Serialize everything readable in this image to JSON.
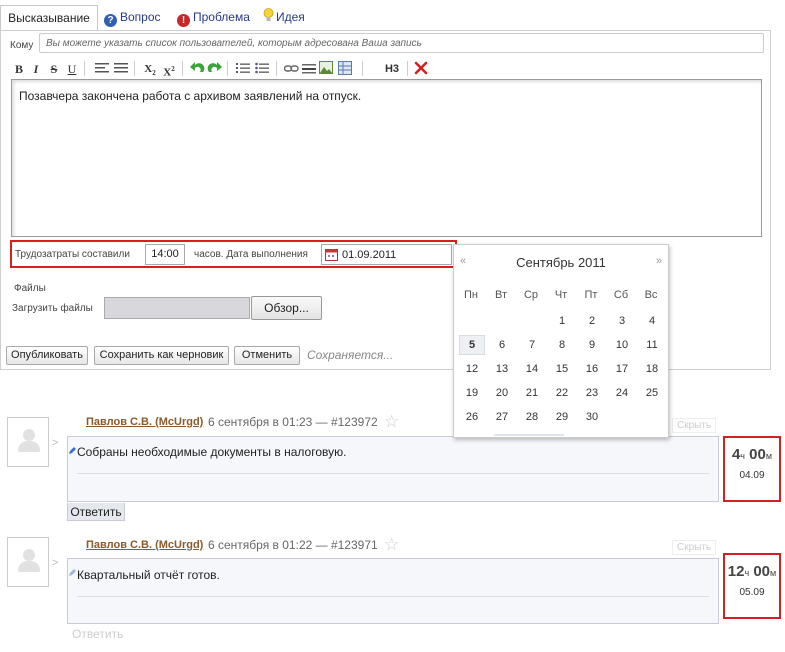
{
  "tabs": [
    {
      "label": "Высказывание",
      "icon": "speech"
    },
    {
      "label": "Вопрос",
      "icon": "question-icon",
      "color": "#2f5fb6"
    },
    {
      "label": "Проблема",
      "icon": "exclamation-icon",
      "color": "#c8262b"
    },
    {
      "label": "Идея",
      "icon": "lightbulb-icon",
      "color": "#f0c419"
    }
  ],
  "to": {
    "label": "Кому",
    "placeholder": "Вы можете указать список пользователей, которым адресована Ваша запись"
  },
  "toolbar": {
    "bold": "B",
    "italic": "I",
    "strike": "S",
    "underline": "U",
    "subscript": "X",
    "superscript": "X",
    "sub_index": "2",
    "sup_index": "2",
    "heading": "H3"
  },
  "editor": {
    "text": "Позавчера закончена работа с архивом заявлений на отпуск."
  },
  "labor": {
    "label": "Трудозатраты составили",
    "hours": "14:00",
    "date_label": "часов. Дата выполнения",
    "date": "01.09.2011"
  },
  "files": {
    "title": "Файлы",
    "upload_label": "Загрузить файлы",
    "browse": "Обзор..."
  },
  "actions": {
    "publish": "Опубликовать",
    "draft": "Сохранить как черновик",
    "cancel": "Отменить",
    "status": "Сохраняется..."
  },
  "calendar": {
    "title": "Сентябрь 2011",
    "prev": "«",
    "next": "»",
    "weekdays": [
      "Пн",
      "Вт",
      "Ср",
      "Чт",
      "Пт",
      "Сб",
      "Вс"
    ],
    "selected_day": "5",
    "weeks": [
      [
        "",
        "",
        "",
        "1",
        "2",
        "3",
        "4"
      ],
      [
        "5",
        "6",
        "7",
        "8",
        "9",
        "10",
        "11"
      ],
      [
        "12",
        "13",
        "14",
        "15",
        "16",
        "17",
        "18"
      ],
      [
        "19",
        "20",
        "21",
        "22",
        "23",
        "24",
        "25"
      ],
      [
        "26",
        "27",
        "28",
        "29",
        "30",
        "",
        ""
      ]
    ]
  },
  "posts": [
    {
      "author": "Павлов С.В. (McUrgd)",
      "meta": "6 сентября в 01:23 — #123972",
      "text": "Собраны необходимые документы в налоговую.",
      "reply": "Ответить",
      "hide": "Скрыть",
      "hours": "4",
      "hours_unit": "ч",
      "minutes": "00",
      "minutes_unit": "м",
      "date": "04.09"
    },
    {
      "author": "Павлов С.В. (McUrgd)",
      "meta": "6 сентября в 01:22 — #123971",
      "text": "Квартальный отчёт готов.",
      "reply": "Ответить",
      "hide": "Скрыть",
      "hours": "12",
      "hours_unit": "ч",
      "minutes": "00",
      "minutes_unit": "м",
      "date": "05.09"
    }
  ],
  "colors": {
    "accent_red": "#d62020",
    "link_blue": "#2a3a8c",
    "author_brown": "#8a5a2b"
  }
}
